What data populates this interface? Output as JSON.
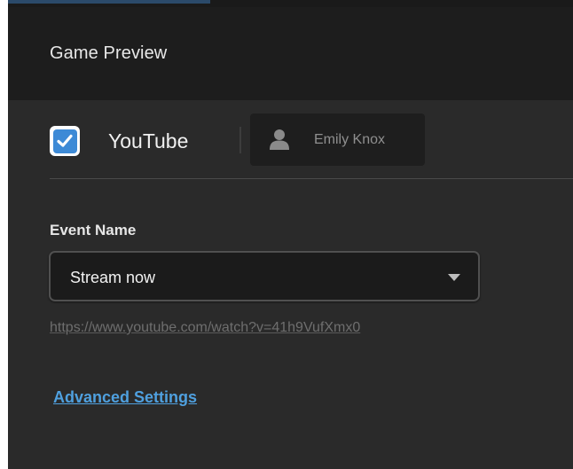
{
  "window": {
    "title": "Game Preview"
  },
  "destination": {
    "checked": true,
    "platform_label": "YouTube",
    "account_name": "Emily Knox"
  },
  "event": {
    "label": "Event Name",
    "selected_value": "Stream now",
    "url": "https://www.youtube.com/watch?v=41h9VufXmx0"
  },
  "links": {
    "advanced_settings": "Advanced Settings"
  },
  "colors": {
    "accent": "#3d8ad6",
    "link": "#4fa0df",
    "panel_bg": "#2a2a2a",
    "header_bg": "#1d1d1d"
  },
  "icons": {
    "checkbox": "checkmark-icon",
    "account": "user-silhouette-icon",
    "dropdown": "caret-down-icon"
  }
}
